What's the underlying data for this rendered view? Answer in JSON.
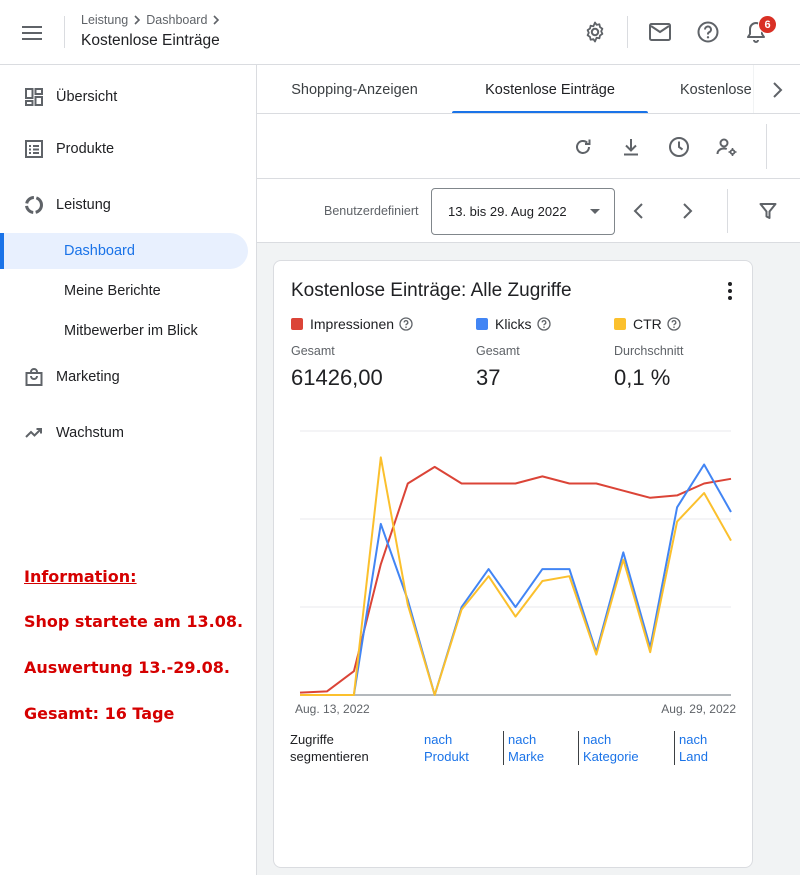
{
  "header": {
    "breadcrumbs": [
      "Leistung",
      "Dashboard"
    ],
    "title": "Kostenlose Einträge",
    "notification_count": "6"
  },
  "sidebar": {
    "items": [
      {
        "label": "Übersicht",
        "icon": "dashboard-icon"
      },
      {
        "label": "Produkte",
        "icon": "list-icon"
      },
      {
        "label": "Leistung",
        "icon": "donut-icon"
      },
      {
        "label": "Marketing",
        "icon": "shopping-bag-icon"
      },
      {
        "label": "Wachstum",
        "icon": "trending-up-icon"
      }
    ],
    "subitems": [
      {
        "label": "Dashboard",
        "active": true
      },
      {
        "label": "Meine Berichte",
        "active": false
      },
      {
        "label": "Mitbewerber im Blick",
        "active": false
      }
    ],
    "notes": [
      "Information:",
      "Shop startete am 13.08.",
      "Auswertung 13.-29.08.",
      "Gesamt: 16 Tage"
    ]
  },
  "tabs": [
    {
      "label": "Shopping-Anzeigen",
      "active": false
    },
    {
      "label": "Kostenlose Einträge",
      "active": true
    },
    {
      "label": "Kostenlose",
      "active": false
    }
  ],
  "filter": {
    "range_label": "Benutzerdefiniert",
    "date_value": "13. bis 29. Aug 2022"
  },
  "card": {
    "title": "Kostenlose Einträge: Alle Zugriffe",
    "metrics": [
      {
        "name": "Impressionen",
        "sub": "Gesamt",
        "value": "61426,00",
        "color": "#db4437"
      },
      {
        "name": "Klicks",
        "sub": "Gesamt",
        "value": "37",
        "color": "#4285f4"
      },
      {
        "name": "CTR",
        "sub": "Durchschnitt",
        "value": "0,1 %",
        "color": "#fbc02d"
      }
    ],
    "segment_label": [
      "Zugriffe",
      "segmentieren"
    ],
    "segment_links": [
      [
        "nach",
        "Produkt"
      ],
      [
        "nach",
        "Marke"
      ],
      [
        "nach",
        "Kategorie"
      ],
      [
        "nach",
        "Land"
      ]
    ]
  },
  "chart_data": {
    "type": "line",
    "x_start_label": "Aug. 13, 2022",
    "x_end_label": "Aug. 29, 2022",
    "grid": true,
    "series": [
      {
        "name": "Impressionen",
        "color": "#db4437",
        "values": [
          0.01,
          0.015,
          0.1,
          0.55,
          0.89,
          0.96,
          0.89,
          0.89,
          0.89,
          0.92,
          0.89,
          0.89,
          0.86,
          0.83,
          0.84,
          0.89,
          0.91
        ]
      },
      {
        "name": "Klicks",
        "color": "#4285f4",
        "values": [
          0,
          0,
          0,
          0.72,
          0.4,
          0,
          0.37,
          0.53,
          0.37,
          0.53,
          0.53,
          0.18,
          0.6,
          0.2,
          0.79,
          0.97,
          0.77
        ]
      },
      {
        "name": "CTR",
        "color": "#fbc02d",
        "values": [
          0,
          0,
          0,
          1.0,
          0.38,
          0,
          0.36,
          0.5,
          0.33,
          0.48,
          0.5,
          0.17,
          0.57,
          0.18,
          0.73,
          0.85,
          0.65
        ]
      }
    ]
  }
}
